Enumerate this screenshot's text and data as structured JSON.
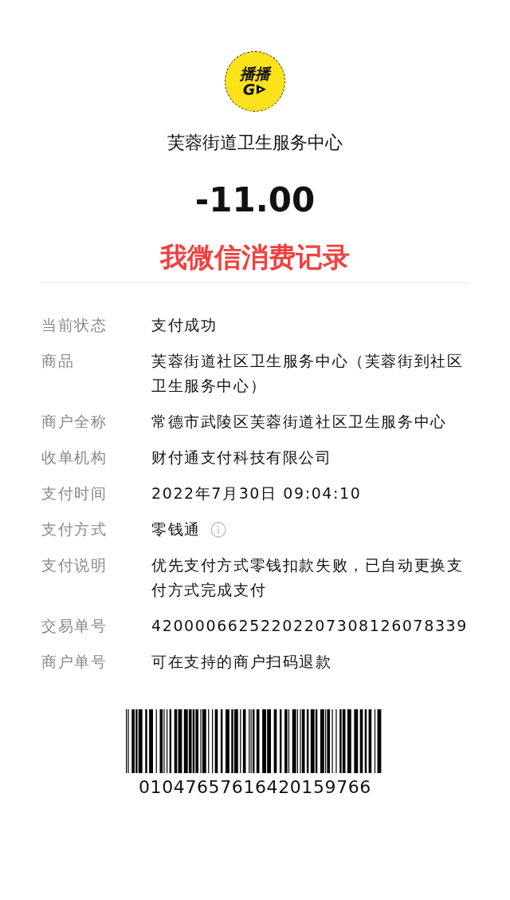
{
  "logo": {
    "lines": [
      "播播",
      "G"
    ]
  },
  "merchant": "芙蓉街道卫生服务中心",
  "amount": "-11.00",
  "annotation": "我微信消费记录",
  "details": [
    {
      "label": "当前状态",
      "value": "支付成功"
    },
    {
      "label": "商品",
      "value": "芙蓉街道社区卫生服务中心（芙蓉街到社区卫生服务中心）"
    },
    {
      "label": "商户全称",
      "value": "常德市武陵区芙蓉街道社区卫生服务中心"
    },
    {
      "label": "收单机构",
      "value": "财付通支付科技有限公司"
    },
    {
      "label": "支付时间",
      "value": "2022年7月30日 09:04:10"
    },
    {
      "label": "支付方式",
      "value": "零钱通",
      "info_icon": true
    },
    {
      "label": "支付说明",
      "value": "优先支付方式零钱扣款失败，已自动更换支付方式完成支付"
    },
    {
      "label": "交易单号",
      "value": "42000066252202207308126078339"
    },
    {
      "label": "商户单号",
      "value": "可在支持的商户扫码退款"
    }
  ],
  "barcode": {
    "number": "01047657616420159766"
  }
}
